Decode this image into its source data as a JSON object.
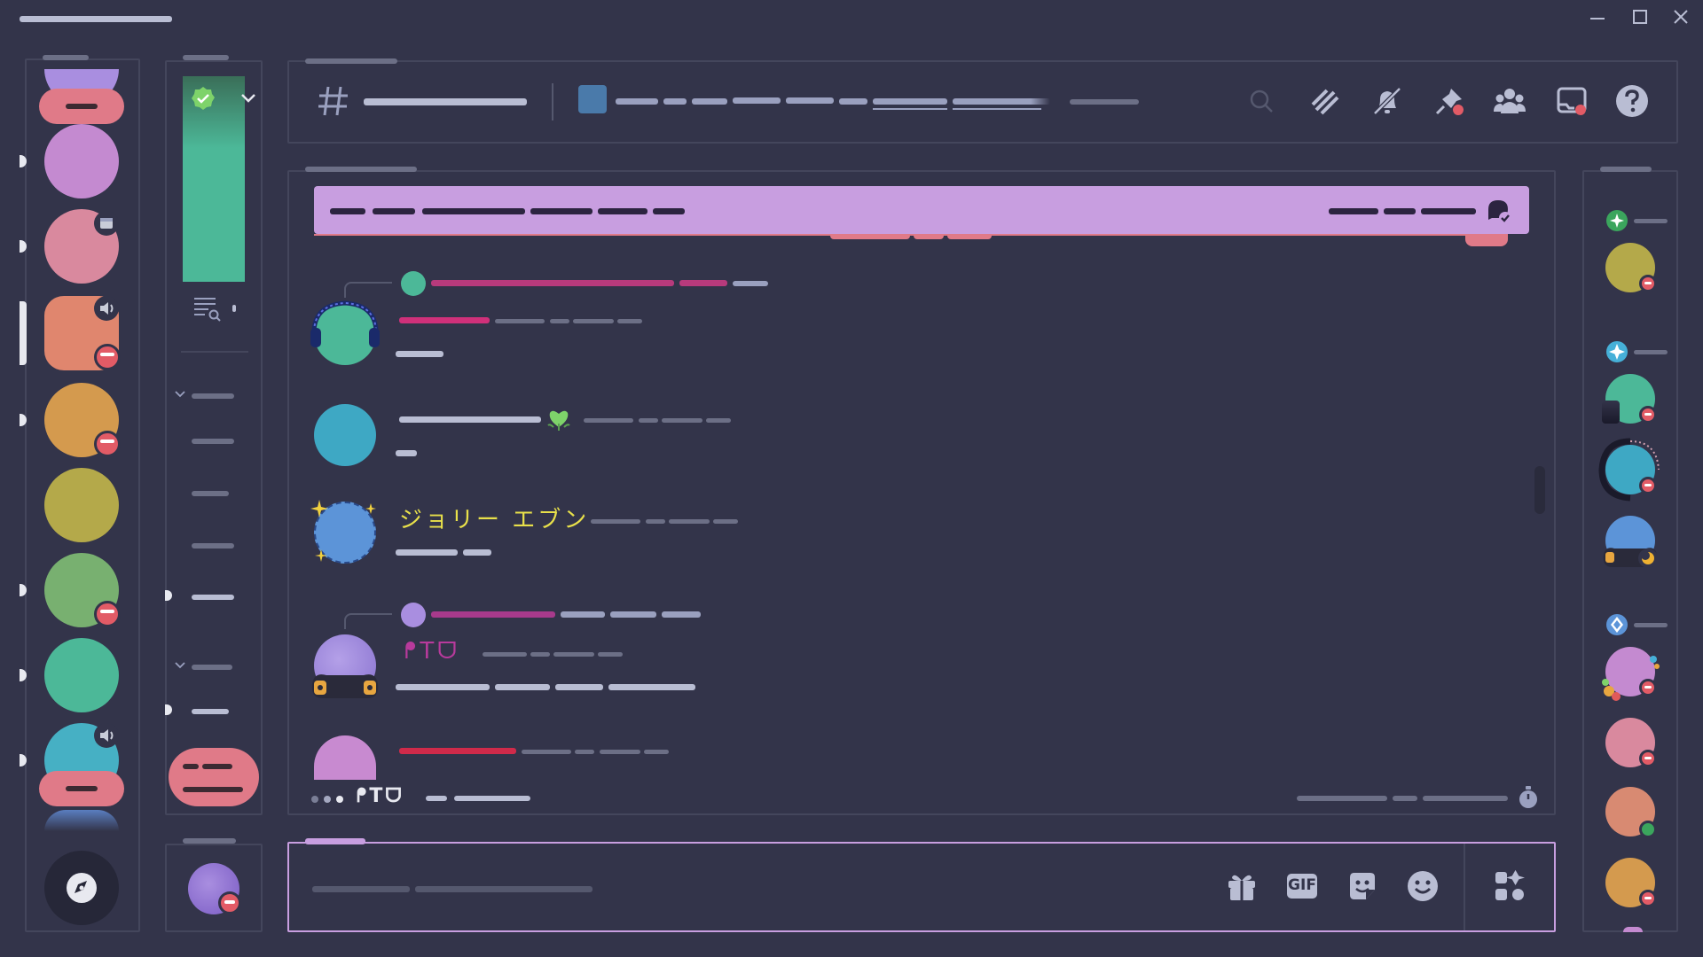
{
  "window": {
    "controls": [
      "minimize",
      "maximize",
      "close"
    ]
  },
  "chat": {
    "messages": [
      {
        "author": "ジョリー エブン",
        "author_color": "#e8e04a"
      },
      {
        "author": "ᖰTᗜ",
        "author_color": "#b83a9c"
      }
    ],
    "typing": {
      "author": "ᖰTᗜ"
    }
  },
  "icons": {
    "channel_hash": "hash-icon",
    "toolbar": [
      "search-icon",
      "threads-icon",
      "notifications-muted-icon",
      "pin-icon",
      "member-list-icon",
      "inbox-icon",
      "help-icon"
    ],
    "composer": [
      "gift-icon",
      "gif-icon",
      "sticker-icon",
      "emoji-icon",
      "apps-icon"
    ],
    "composer_gif_label": "GIF"
  },
  "colors": {
    "background": "#33344a",
    "banner": "#c89ee0",
    "accent_pink": "#e07a88",
    "composer_border": "#c89ee0",
    "dnd": "#e25b66",
    "online": "#3ba55d"
  }
}
